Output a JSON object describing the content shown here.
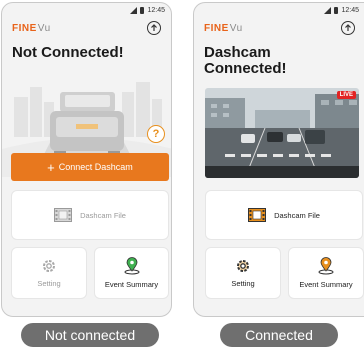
{
  "panels": [
    {
      "status_time": "12:45",
      "logo": {
        "fine": "FINE",
        "vu": "Vu"
      },
      "title": "Not Connected!",
      "help": "?",
      "connect_button": {
        "plus": "+",
        "label": "Connect Dashcam"
      },
      "dashcam_file": "Dashcam File",
      "setting": "Setting",
      "event_summary": "Event Summary",
      "caption": "Not connected"
    },
    {
      "status_time": "12:45",
      "logo": {
        "fine": "FINE",
        "vu": "Vu"
      },
      "title_line1": "Dashcam",
      "title_line2": "Connected!",
      "live_badge": "LIVE",
      "dashcam_file": "Dashcam File",
      "setting": "Setting",
      "event_summary": "Event Summary",
      "caption": "Connected"
    }
  ],
  "colors": {
    "accent": "#e8781e",
    "live": "#e22323",
    "caption_bg": "#6f6f6f"
  },
  "icons": [
    "signal-icon",
    "battery-icon",
    "upload-icon",
    "help-icon",
    "film-icon",
    "gear-icon",
    "location-pin-icon"
  ]
}
